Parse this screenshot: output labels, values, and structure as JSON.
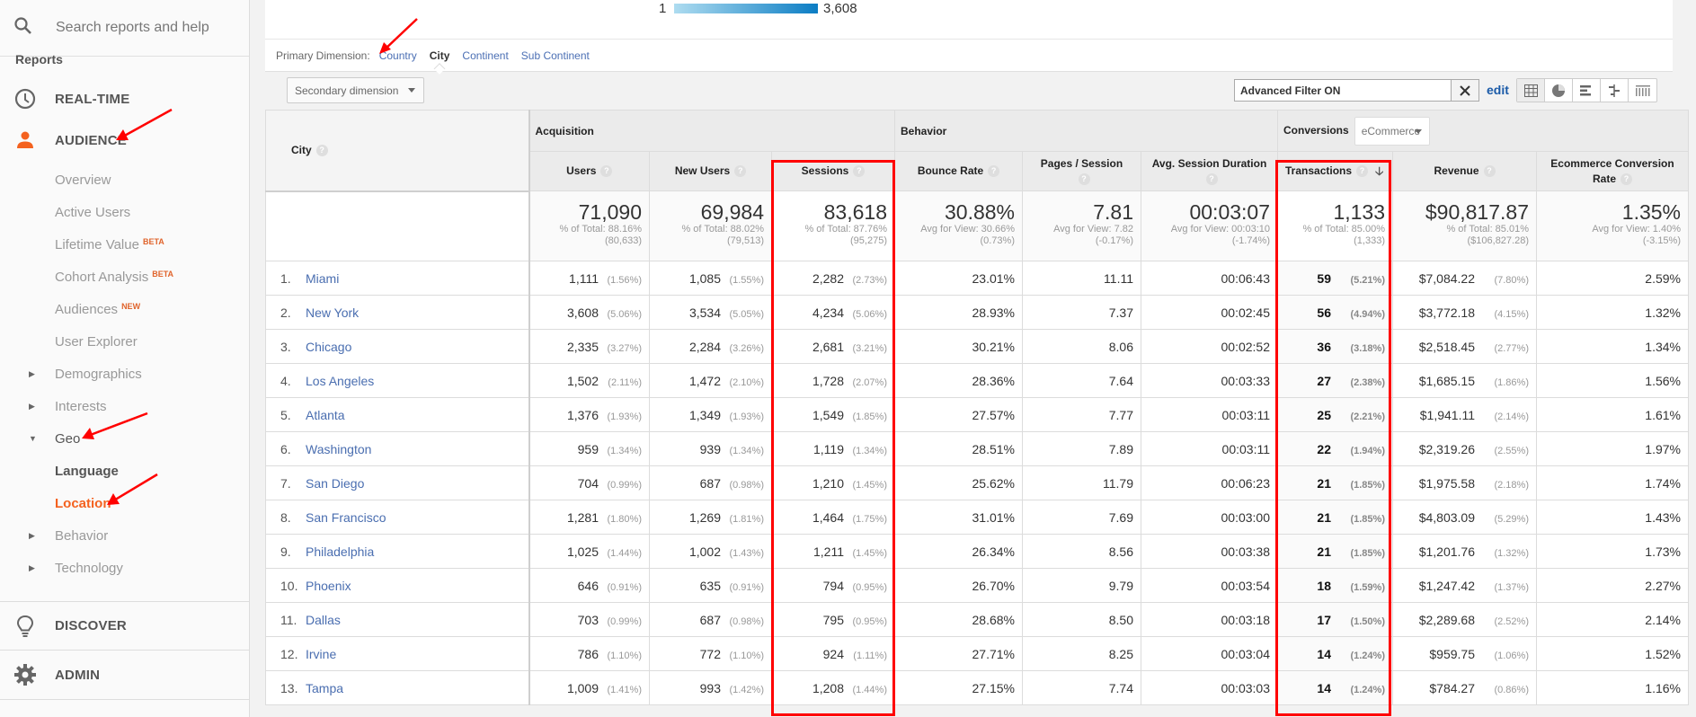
{
  "sidebar": {
    "search_placeholder": "Search reports and help",
    "reports_label": "Reports",
    "realtime": "REAL-TIME",
    "audience": "AUDIENCE",
    "audience_items": [
      {
        "label": "Overview",
        "badge": ""
      },
      {
        "label": "Active Users",
        "badge": ""
      },
      {
        "label": "Lifetime Value",
        "badge": "BETA"
      },
      {
        "label": "Cohort Analysis",
        "badge": "BETA"
      },
      {
        "label": "Audiences",
        "badge": "NEW"
      },
      {
        "label": "User Explorer",
        "badge": ""
      }
    ],
    "tree": {
      "demographics": "Demographics",
      "interests": "Interests",
      "geo": "Geo",
      "language": "Language",
      "location": "Location",
      "behavior": "Behavior",
      "technology": "Technology"
    },
    "discover": "DISCOVER",
    "admin": "ADMIN",
    "active_color": "#f4621f"
  },
  "map_legend": {
    "min": "1",
    "max": "3,608"
  },
  "primary_dimension": {
    "label": "Primary Dimension:",
    "options": [
      "Country",
      "City",
      "Continent",
      "Sub Continent"
    ],
    "selected": "City"
  },
  "toolbar": {
    "secondary_dimension": "Secondary dimension",
    "filter_value": "Advanced Filter ON",
    "edit_label": "edit",
    "views": [
      "table-view",
      "pie-view",
      "performance-view",
      "comparison-view",
      "pivot-view"
    ]
  },
  "table": {
    "groups": {
      "acquisition": "Acquisition",
      "behavior": "Behavior",
      "conversions": "Conversions",
      "conversions_select": "eCommerce"
    },
    "columns": {
      "city": "City",
      "users": "Users",
      "new_users": "New Users",
      "sessions": "Sessions",
      "bounce_rate": "Bounce Rate",
      "pages_session": "Pages / Session",
      "avg_duration": "Avg. Session Duration",
      "transactions": "Transactions",
      "revenue": "Revenue",
      "ecr": "Ecommerce Conversion Rate"
    },
    "totals": {
      "users": {
        "value": "71,090",
        "line1": "% of Total: 88.16%",
        "line2": "(80,633)"
      },
      "new_users": {
        "value": "69,984",
        "line1": "% of Total: 88.02%",
        "line2": "(79,513)"
      },
      "sessions": {
        "value": "83,618",
        "line1": "% of Total: 87.76%",
        "line2": "(95,275)"
      },
      "bounce_rate": {
        "value": "30.88%",
        "line1": "Avg for View: 30.66%",
        "line2": "(0.73%)"
      },
      "pages_session": {
        "value": "7.81",
        "line1": "Avg for View: 7.82",
        "line2": "(-0.17%)"
      },
      "avg_duration": {
        "value": "00:03:07",
        "line1": "Avg for View: 00:03:10",
        "line2": "(-1.74%)"
      },
      "transactions": {
        "value": "1,133",
        "line1": "% of Total: 85.00%",
        "line2": "(1,333)"
      },
      "revenue": {
        "value": "$90,817.87",
        "line1": "% of Total: 85.01%",
        "line2": "($106,827.28)"
      },
      "ecr": {
        "value": "1.35%",
        "line1": "Avg for View: 1.40%",
        "line2": "(-3.15%)"
      }
    },
    "rows": [
      {
        "idx": "1.",
        "city": "Miami",
        "users": "1,111",
        "users_pct": "(1.56%)",
        "new_users": "1,085",
        "new_users_pct": "(1.55%)",
        "sessions": "2,282",
        "sessions_pct": "(2.73%)",
        "bounce": "23.01%",
        "pps": "11.11",
        "dur": "00:06:43",
        "tx": "59",
        "tx_pct": "(5.21%)",
        "rev": "$7,084.22",
        "rev_pct": "(7.80%)",
        "ecr": "2.59%"
      },
      {
        "idx": "2.",
        "city": "New York",
        "users": "3,608",
        "users_pct": "(5.06%)",
        "new_users": "3,534",
        "new_users_pct": "(5.05%)",
        "sessions": "4,234",
        "sessions_pct": "(5.06%)",
        "bounce": "28.93%",
        "pps": "7.37",
        "dur": "00:02:45",
        "tx": "56",
        "tx_pct": "(4.94%)",
        "rev": "$3,772.18",
        "rev_pct": "(4.15%)",
        "ecr": "1.32%"
      },
      {
        "idx": "3.",
        "city": "Chicago",
        "users": "2,335",
        "users_pct": "(3.27%)",
        "new_users": "2,284",
        "new_users_pct": "(3.26%)",
        "sessions": "2,681",
        "sessions_pct": "(3.21%)",
        "bounce": "30.21%",
        "pps": "8.06",
        "dur": "00:02:52",
        "tx": "36",
        "tx_pct": "(3.18%)",
        "rev": "$2,518.45",
        "rev_pct": "(2.77%)",
        "ecr": "1.34%"
      },
      {
        "idx": "4.",
        "city": "Los Angeles",
        "users": "1,502",
        "users_pct": "(2.11%)",
        "new_users": "1,472",
        "new_users_pct": "(2.10%)",
        "sessions": "1,728",
        "sessions_pct": "(2.07%)",
        "bounce": "28.36%",
        "pps": "7.64",
        "dur": "00:03:33",
        "tx": "27",
        "tx_pct": "(2.38%)",
        "rev": "$1,685.15",
        "rev_pct": "(1.86%)",
        "ecr": "1.56%"
      },
      {
        "idx": "5.",
        "city": "Atlanta",
        "users": "1,376",
        "users_pct": "(1.93%)",
        "new_users": "1,349",
        "new_users_pct": "(1.93%)",
        "sessions": "1,549",
        "sessions_pct": "(1.85%)",
        "bounce": "27.57%",
        "pps": "7.77",
        "dur": "00:03:11",
        "tx": "25",
        "tx_pct": "(2.21%)",
        "rev": "$1,941.11",
        "rev_pct": "(2.14%)",
        "ecr": "1.61%"
      },
      {
        "idx": "6.",
        "city": "Washington",
        "users": "959",
        "users_pct": "(1.34%)",
        "new_users": "939",
        "new_users_pct": "(1.34%)",
        "sessions": "1,119",
        "sessions_pct": "(1.34%)",
        "bounce": "28.51%",
        "pps": "7.89",
        "dur": "00:03:11",
        "tx": "22",
        "tx_pct": "(1.94%)",
        "rev": "$2,319.26",
        "rev_pct": "(2.55%)",
        "ecr": "1.97%"
      },
      {
        "idx": "7.",
        "city": "San Diego",
        "users": "704",
        "users_pct": "(0.99%)",
        "new_users": "687",
        "new_users_pct": "(0.98%)",
        "sessions": "1,210",
        "sessions_pct": "(1.45%)",
        "bounce": "25.62%",
        "pps": "11.79",
        "dur": "00:06:23",
        "tx": "21",
        "tx_pct": "(1.85%)",
        "rev": "$1,975.58",
        "rev_pct": "(2.18%)",
        "ecr": "1.74%"
      },
      {
        "idx": "8.",
        "city": "San Francisco",
        "users": "1,281",
        "users_pct": "(1.80%)",
        "new_users": "1,269",
        "new_users_pct": "(1.81%)",
        "sessions": "1,464",
        "sessions_pct": "(1.75%)",
        "bounce": "31.01%",
        "pps": "7.69",
        "dur": "00:03:00",
        "tx": "21",
        "tx_pct": "(1.85%)",
        "rev": "$4,803.09",
        "rev_pct": "(5.29%)",
        "ecr": "1.43%"
      },
      {
        "idx": "9.",
        "city": "Philadelphia",
        "users": "1,025",
        "users_pct": "(1.44%)",
        "new_users": "1,002",
        "new_users_pct": "(1.43%)",
        "sessions": "1,211",
        "sessions_pct": "(1.45%)",
        "bounce": "26.34%",
        "pps": "8.56",
        "dur": "00:03:38",
        "tx": "21",
        "tx_pct": "(1.85%)",
        "rev": "$1,201.76",
        "rev_pct": "(1.32%)",
        "ecr": "1.73%"
      },
      {
        "idx": "10.",
        "city": "Phoenix",
        "users": "646",
        "users_pct": "(0.91%)",
        "new_users": "635",
        "new_users_pct": "(0.91%)",
        "sessions": "794",
        "sessions_pct": "(0.95%)",
        "bounce": "26.70%",
        "pps": "9.79",
        "dur": "00:03:54",
        "tx": "18",
        "tx_pct": "(1.59%)",
        "rev": "$1,247.42",
        "rev_pct": "(1.37%)",
        "ecr": "2.27%"
      },
      {
        "idx": "11.",
        "city": "Dallas",
        "users": "703",
        "users_pct": "(0.99%)",
        "new_users": "687",
        "new_users_pct": "(0.98%)",
        "sessions": "795",
        "sessions_pct": "(0.95%)",
        "bounce": "28.68%",
        "pps": "8.50",
        "dur": "00:03:18",
        "tx": "17",
        "tx_pct": "(1.50%)",
        "rev": "$2,289.68",
        "rev_pct": "(2.52%)",
        "ecr": "2.14%"
      },
      {
        "idx": "12.",
        "city": "Irvine",
        "users": "786",
        "users_pct": "(1.10%)",
        "new_users": "772",
        "new_users_pct": "(1.10%)",
        "sessions": "924",
        "sessions_pct": "(1.11%)",
        "bounce": "27.71%",
        "pps": "8.25",
        "dur": "00:03:04",
        "tx": "14",
        "tx_pct": "(1.24%)",
        "rev": "$959.75",
        "rev_pct": "(1.06%)",
        "ecr": "1.52%"
      },
      {
        "idx": "13.",
        "city": "Tampa",
        "users": "1,009",
        "users_pct": "(1.41%)",
        "new_users": "993",
        "new_users_pct": "(1.42%)",
        "sessions": "1,208",
        "sessions_pct": "(1.44%)",
        "bounce": "27.15%",
        "pps": "7.74",
        "dur": "00:03:03",
        "tx": "14",
        "tx_pct": "(1.24%)",
        "rev": "$784.27",
        "rev_pct": "(0.86%)",
        "ecr": "1.16%"
      }
    ]
  },
  "annotations": {
    "highlight_color": "#ff0000"
  }
}
